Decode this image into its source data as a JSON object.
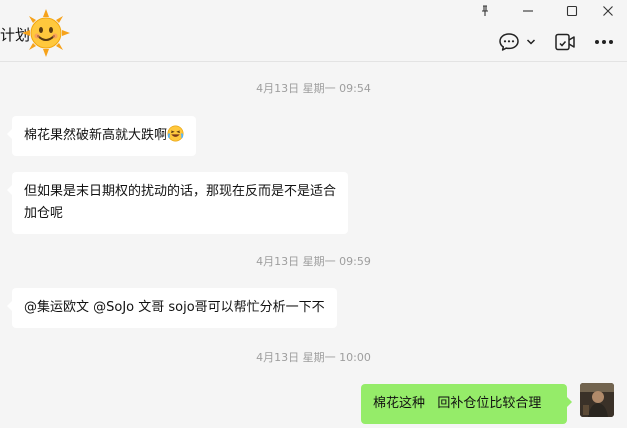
{
  "window": {
    "pin_label": "pin",
    "minimize_label": "minimize",
    "maximize_label": "maximize",
    "close_label": "close"
  },
  "header": {
    "title": "计划"
  },
  "messages": [
    {
      "type": "time",
      "text": "4月13日 星期一 09:54"
    },
    {
      "type": "incoming",
      "text": "棉花果然破新高就大跌啊",
      "emoji": "laughing-tears"
    },
    {
      "type": "incoming",
      "lines": [
        "但如果是末日期权的扰动的话，那现在反而是不是适合",
        "加仓呢"
      ]
    },
    {
      "type": "time",
      "text": "4月13日 星期一 09:59"
    },
    {
      "type": "incoming",
      "text": "@集运欧文 @SoJo 文哥 sojo哥可以帮忙分析一下不"
    },
    {
      "type": "time",
      "text": "4月13日 星期一 10:00"
    },
    {
      "type": "outgoing",
      "text": "棉花这种   回补仓位比较合理"
    }
  ],
  "colors": {
    "background": "#f5f5f5",
    "incoming_bubble": "#ffffff",
    "outgoing_bubble": "#95ec69",
    "timestamp": "#9e9e9e"
  },
  "icons": [
    "pin-icon",
    "minimize-icon",
    "maximize-icon",
    "close-icon",
    "chat-bubble-icon",
    "chevron-down-icon",
    "video-call-icon",
    "more-icon",
    "sun-emoji",
    "laughing-tears-emoji"
  ]
}
